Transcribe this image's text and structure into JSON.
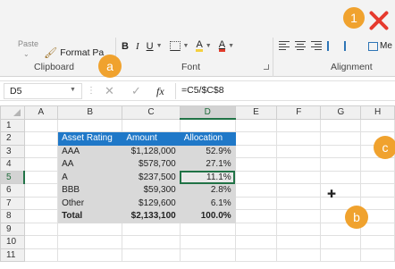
{
  "ribbon": {
    "clipboard": {
      "paste_label": "Paste",
      "format_painter_label": "Format Pa",
      "group_label": "Clipboard"
    },
    "font": {
      "bold": "B",
      "italic": "I",
      "underline": "U",
      "fill_letter": "A",
      "font_color_letter": "A",
      "group_label": "Font"
    },
    "alignment": {
      "merge_label": "Me",
      "group_label": "Alignment"
    }
  },
  "badges": {
    "one": "1",
    "a": "a",
    "b": "b",
    "c": "c"
  },
  "formula_bar": {
    "name_box": "D5",
    "fx_label": "fx",
    "formula": "=C5/$C$8"
  },
  "grid": {
    "columns": [
      "A",
      "B",
      "C",
      "D",
      "E",
      "F",
      "G",
      "H"
    ],
    "rows": [
      {
        "num": "1",
        "b": "",
        "c": "",
        "d": ""
      },
      {
        "num": "2",
        "b": "Asset Rating",
        "c": "Amount",
        "d": "Allocation"
      },
      {
        "num": "3",
        "b": "AAA",
        "c": "$1,128,000",
        "d": "52.9%"
      },
      {
        "num": "4",
        "b": "AA",
        "c": "$578,700",
        "d": "27.1%"
      },
      {
        "num": "5",
        "b": "A",
        "c": "$237,500",
        "d": "11.1%"
      },
      {
        "num": "6",
        "b": "BBB",
        "c": "$59,300",
        "d": "2.8%"
      },
      {
        "num": "7",
        "b": "Other",
        "c": "$129,600",
        "d": "6.1%"
      },
      {
        "num": "8",
        "b": "Total",
        "c": "$2,133,100",
        "d": "100.0%"
      },
      {
        "num": "9",
        "b": "",
        "c": "",
        "d": ""
      },
      {
        "num": "10",
        "b": "",
        "c": "",
        "d": ""
      },
      {
        "num": "11",
        "b": "",
        "c": "",
        "d": ""
      }
    ],
    "active_cell": "D5"
  },
  "colors": {
    "header_fill": "#1f78c8",
    "table_fill": "#d9d9d9",
    "selection": "#217346",
    "badge": "#f0a22e",
    "close": "#e63a2e"
  },
  "icons": [
    "format-painter-icon",
    "borders-icon",
    "fill-color-icon",
    "font-color-icon",
    "align-left-icon",
    "align-center-icon",
    "align-right-icon",
    "decrease-indent-icon",
    "increase-indent-icon",
    "merge-icon",
    "close-icon",
    "cursor-plus-icon"
  ]
}
